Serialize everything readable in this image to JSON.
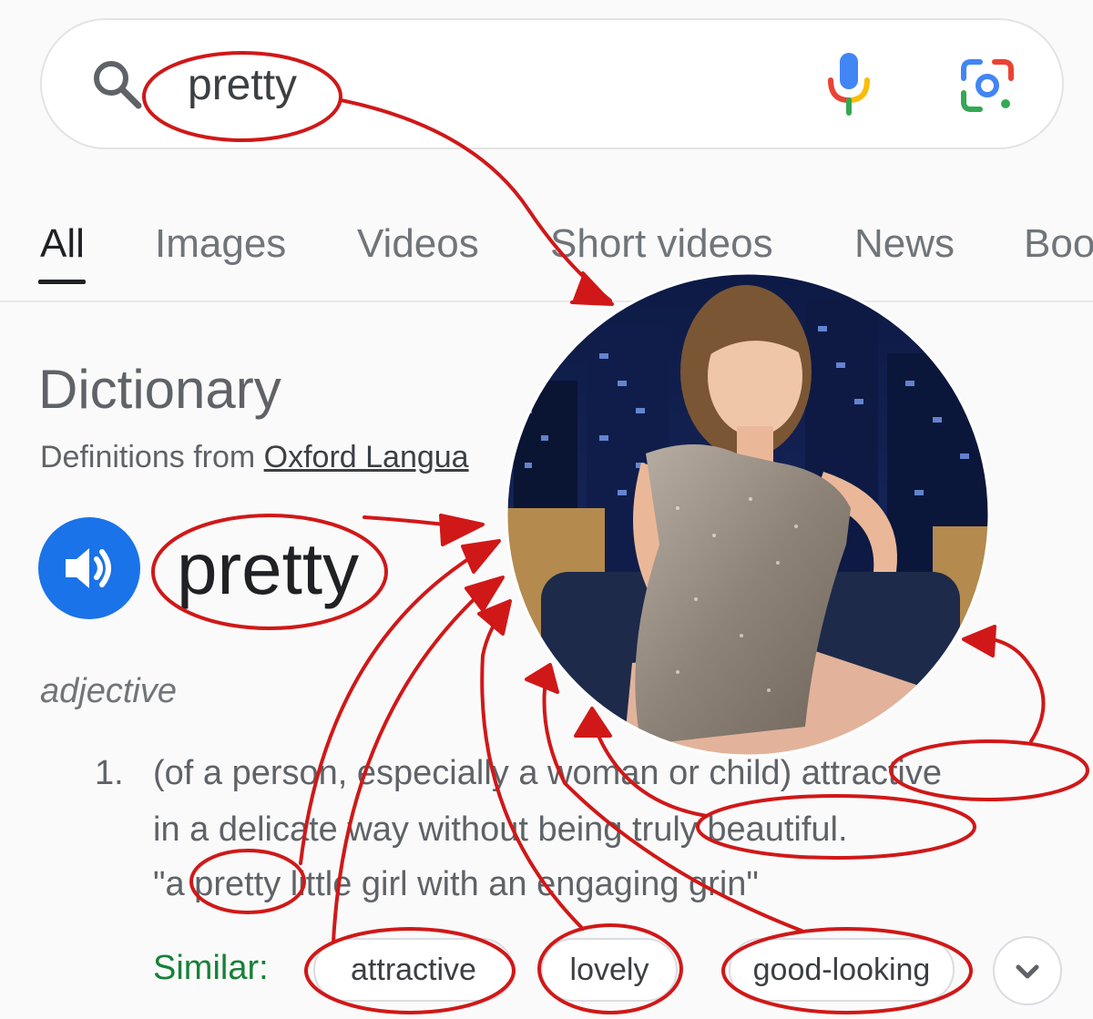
{
  "search": {
    "query": "pretty"
  },
  "tabs": [
    {
      "label": "All",
      "selected": true
    },
    {
      "label": "Images"
    },
    {
      "label": "Videos"
    },
    {
      "label": "Short videos"
    },
    {
      "label": "News"
    },
    {
      "label": "Boo"
    }
  ],
  "dictionary": {
    "heading": "Dictionary",
    "subtitle_prefix": "Definitions from ",
    "source": "Oxford Langua",
    "word": "pretty",
    "part_of_speech": "adjective",
    "definition_number": "1.",
    "definition_line1": "(of a person, especially a woman or child) attractive",
    "definition_line2": "in a delicate way without being truly beautiful.",
    "example": "\"a pretty little girl with an engaging grin\"",
    "similar_label": "Similar:",
    "similar": [
      "attractive",
      "lovely",
      "good-looking"
    ]
  },
  "icons": {
    "search": "search-icon",
    "mic": "mic-icon",
    "lens": "google-lens-icon",
    "speaker": "speaker-icon",
    "expand": "chevron-down-icon"
  },
  "colors": {
    "annotation_red": "#d01818",
    "link_blue": "#1a73e8",
    "similar_green": "#188038"
  }
}
